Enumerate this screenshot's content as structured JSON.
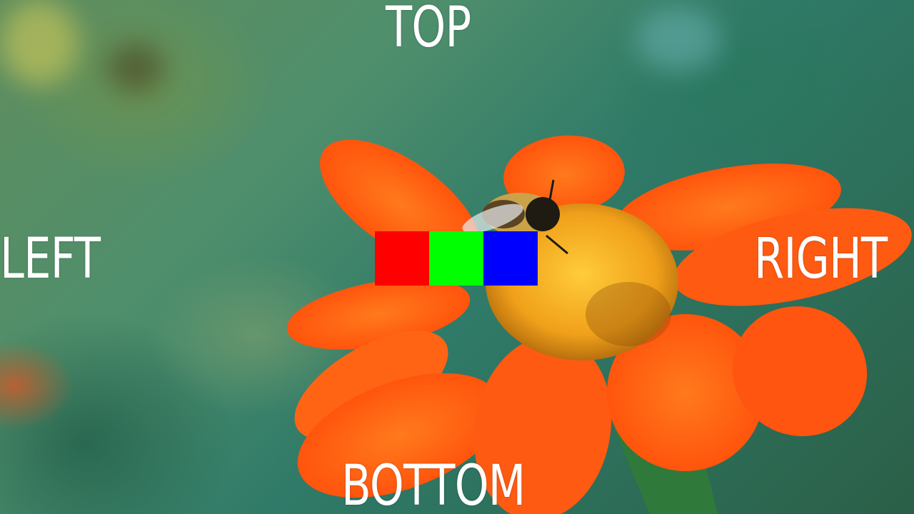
{
  "labels": {
    "top": "TOP",
    "left": "LEFT",
    "right": "RIGHT",
    "bottom": "BOTTOM"
  },
  "swatches": [
    {
      "name": "red",
      "color": "#ff0000"
    },
    {
      "name": "green",
      "color": "#00ff00"
    },
    {
      "name": "blue",
      "color": "#0000ff"
    }
  ],
  "colors": {
    "petal": "#ff5a12",
    "center": "#f2a51a",
    "background": "#3f7a60"
  }
}
